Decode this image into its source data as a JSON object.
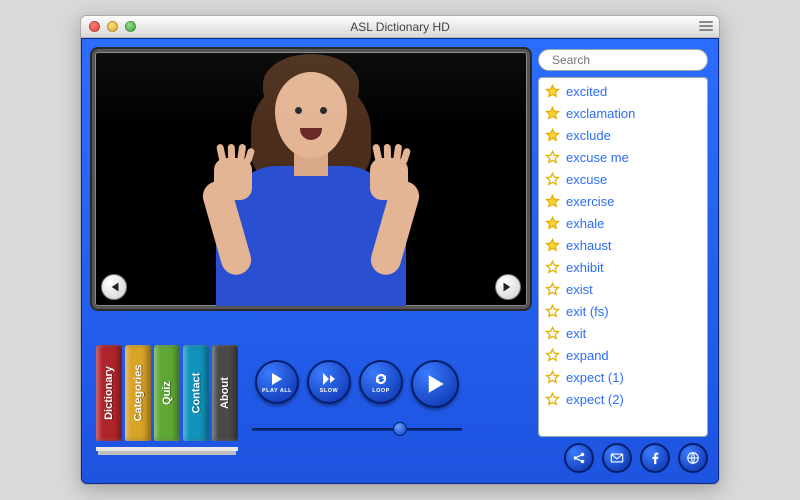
{
  "window": {
    "title": "ASL Dictionary HD"
  },
  "search": {
    "placeholder": "Search"
  },
  "books": [
    {
      "label": "Dictionary",
      "color": "#b0252b"
    },
    {
      "label": "Categories",
      "color": "#d9a428"
    },
    {
      "label": "Quiz",
      "color": "#5fa836"
    },
    {
      "label": "Contact",
      "color": "#1094bd"
    },
    {
      "label": "About",
      "color": "#4a4a4a"
    }
  ],
  "controls": {
    "play_all": "PLAY ALL",
    "slow": "SLOW",
    "loop": "LOOP"
  },
  "slider": {
    "position_pct": 72
  },
  "words": [
    {
      "text": "excited",
      "fav": true
    },
    {
      "text": "exclamation",
      "fav": true
    },
    {
      "text": "exclude",
      "fav": true
    },
    {
      "text": "excuse me",
      "fav": false
    },
    {
      "text": "excuse",
      "fav": false
    },
    {
      "text": "exercise",
      "fav": true
    },
    {
      "text": "exhale",
      "fav": true
    },
    {
      "text": "exhaust",
      "fav": true
    },
    {
      "text": "exhibit",
      "fav": false
    },
    {
      "text": "exist",
      "fav": false
    },
    {
      "text": "exit (fs)",
      "fav": false
    },
    {
      "text": "exit",
      "fav": false
    },
    {
      "text": "expand",
      "fav": false
    },
    {
      "text": "expect (1)",
      "fav": false
    },
    {
      "text": "expect (2)",
      "fav": false
    }
  ]
}
